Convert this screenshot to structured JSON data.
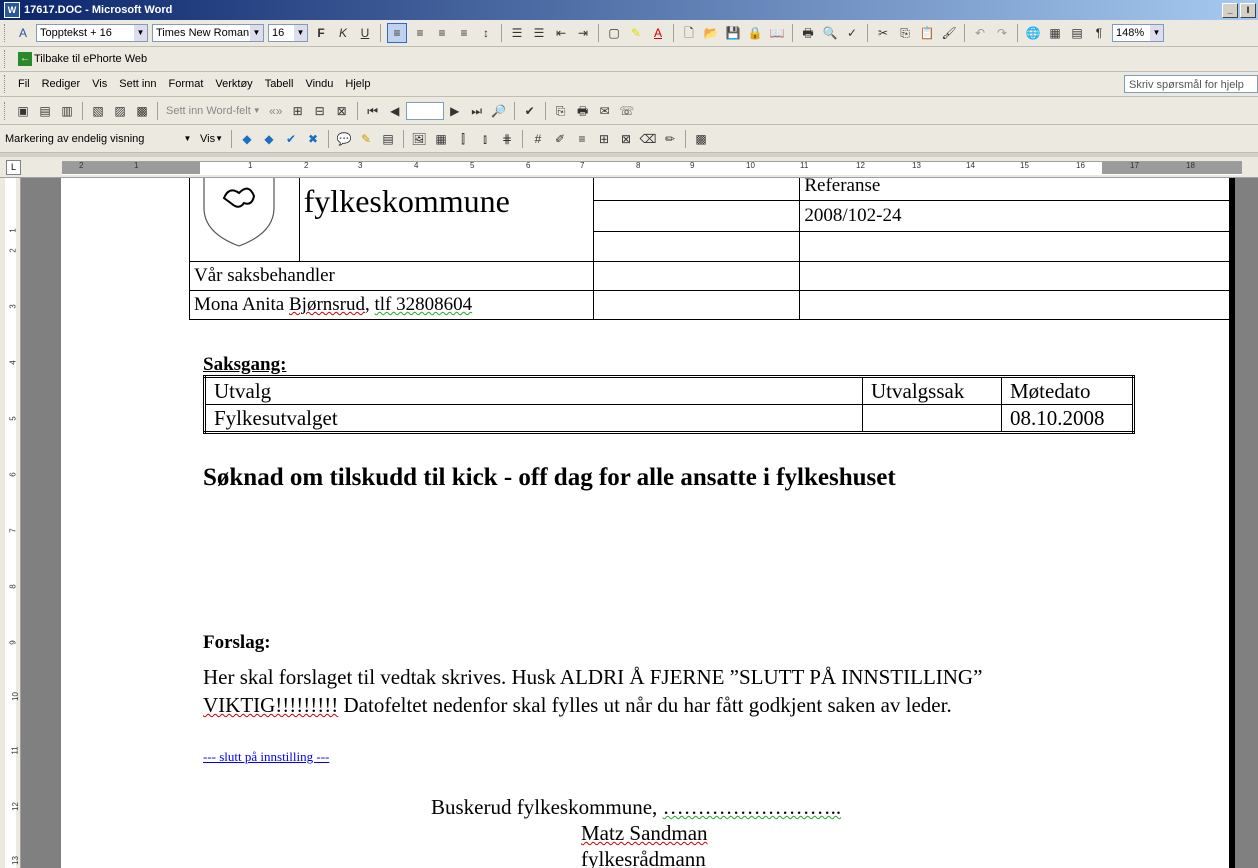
{
  "window": {
    "title": "17617.DOC - Microsoft Word",
    "min_label": "_",
    "close_label": "I"
  },
  "formatting_toolbar": {
    "style": "Topptekst + 16",
    "font": "Times New Roman",
    "size": "16",
    "bold": "F",
    "italic": "K",
    "underline": "U",
    "zoom": "148%"
  },
  "ephorte_toolbar": {
    "back_label": "Tilbake til ePhorte Web"
  },
  "menu": {
    "items": [
      "Fil",
      "Rediger",
      "Vis",
      "Sett inn",
      "Format",
      "Verktøy",
      "Tabell",
      "Vindu",
      "Hjelp"
    ],
    "help_placeholder": "Skriv spørsmål for hjelp"
  },
  "mailmerge_toolbar": {
    "insert_field": "Sett inn Word-felt"
  },
  "review_toolbar": {
    "display_mode": "Markering av endelig visning",
    "show_label": "Vis"
  },
  "ruler": {
    "h_numbers": [
      "2",
      "1",
      "1",
      "2",
      "3",
      "4",
      "5",
      "6",
      "7",
      "8",
      "9",
      "10",
      "11",
      "12",
      "13",
      "14",
      "15",
      "16",
      "17",
      "18"
    ],
    "v_numbers": [
      "1",
      "2",
      "3",
      "4",
      "5",
      "6",
      "7",
      "8",
      "9",
      "10",
      "11",
      "12",
      "13"
    ]
  },
  "document": {
    "header": {
      "org": "fylkeskommune",
      "ref_label": "Referanse",
      "ref_value": "2008/102-24",
      "handler_label": "Vår saksbehandler",
      "handler_value_pre": "Mona Anita ",
      "handler_value_name": "Bjørnsrud",
      "handler_value_post": ", ",
      "handler_phone": "tlf 32808604"
    },
    "saksgang": {
      "heading": "Saksgang:",
      "columns": [
        "Utvalg",
        "Utvalgssak",
        "Møtedato"
      ],
      "rows": [
        [
          "Fylkesutvalget",
          "",
          "08.10.2008"
        ]
      ]
    },
    "title": "Søknad om tilskudd til kick - off dag for alle ansatte i fylkeshuset",
    "forslag_heading": "Forslag:",
    "forslag_text_1": "Her skal forslaget til vedtak skrives. Husk ALDRI Å FJERNE ”SLUTT PÅ INNSTILLING”",
    "forslag_text_2a": "VIKTIG!!!!!!!!!",
    "forslag_text_2b": " Datofeltet nedenfor skal fylles ut når du har fått godkjent saken av leder.",
    "slutt": "--- slutt på innstilling ---",
    "sign_line_pre": "Buskerud fylkeskommune, ",
    "sign_line_dots": "……………………..",
    "sign_name": "Matz Sandman",
    "sign_title": "fylkesrådmann"
  }
}
